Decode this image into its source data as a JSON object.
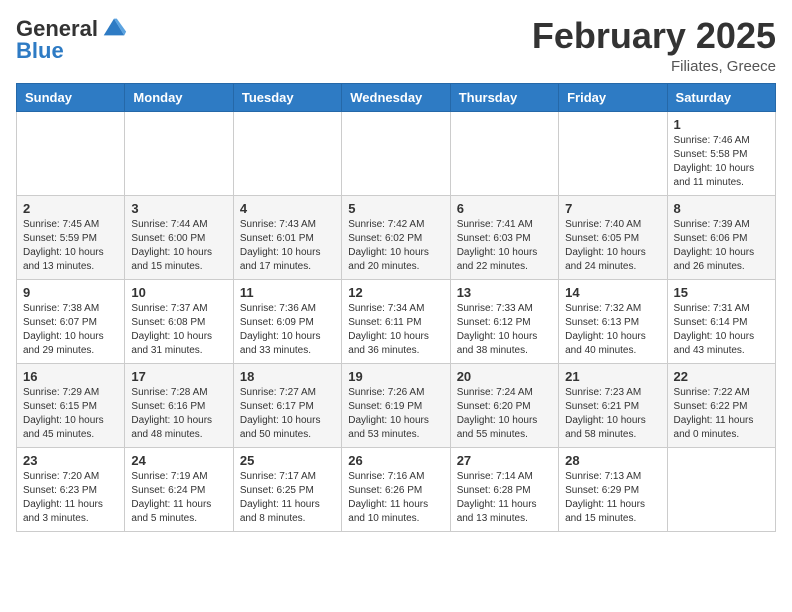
{
  "header": {
    "logo_general": "General",
    "logo_blue": "Blue",
    "month_title": "February 2025",
    "subtitle": "Filiates, Greece"
  },
  "days_of_week": [
    "Sunday",
    "Monday",
    "Tuesday",
    "Wednesday",
    "Thursday",
    "Friday",
    "Saturday"
  ],
  "weeks": [
    [
      {
        "day": "",
        "info": ""
      },
      {
        "day": "",
        "info": ""
      },
      {
        "day": "",
        "info": ""
      },
      {
        "day": "",
        "info": ""
      },
      {
        "day": "",
        "info": ""
      },
      {
        "day": "",
        "info": ""
      },
      {
        "day": "1",
        "info": "Sunrise: 7:46 AM\nSunset: 5:58 PM\nDaylight: 10 hours and 11 minutes."
      }
    ],
    [
      {
        "day": "2",
        "info": "Sunrise: 7:45 AM\nSunset: 5:59 PM\nDaylight: 10 hours and 13 minutes."
      },
      {
        "day": "3",
        "info": "Sunrise: 7:44 AM\nSunset: 6:00 PM\nDaylight: 10 hours and 15 minutes."
      },
      {
        "day": "4",
        "info": "Sunrise: 7:43 AM\nSunset: 6:01 PM\nDaylight: 10 hours and 17 minutes."
      },
      {
        "day": "5",
        "info": "Sunrise: 7:42 AM\nSunset: 6:02 PM\nDaylight: 10 hours and 20 minutes."
      },
      {
        "day": "6",
        "info": "Sunrise: 7:41 AM\nSunset: 6:03 PM\nDaylight: 10 hours and 22 minutes."
      },
      {
        "day": "7",
        "info": "Sunrise: 7:40 AM\nSunset: 6:05 PM\nDaylight: 10 hours and 24 minutes."
      },
      {
        "day": "8",
        "info": "Sunrise: 7:39 AM\nSunset: 6:06 PM\nDaylight: 10 hours and 26 minutes."
      }
    ],
    [
      {
        "day": "9",
        "info": "Sunrise: 7:38 AM\nSunset: 6:07 PM\nDaylight: 10 hours and 29 minutes."
      },
      {
        "day": "10",
        "info": "Sunrise: 7:37 AM\nSunset: 6:08 PM\nDaylight: 10 hours and 31 minutes."
      },
      {
        "day": "11",
        "info": "Sunrise: 7:36 AM\nSunset: 6:09 PM\nDaylight: 10 hours and 33 minutes."
      },
      {
        "day": "12",
        "info": "Sunrise: 7:34 AM\nSunset: 6:11 PM\nDaylight: 10 hours and 36 minutes."
      },
      {
        "day": "13",
        "info": "Sunrise: 7:33 AM\nSunset: 6:12 PM\nDaylight: 10 hours and 38 minutes."
      },
      {
        "day": "14",
        "info": "Sunrise: 7:32 AM\nSunset: 6:13 PM\nDaylight: 10 hours and 40 minutes."
      },
      {
        "day": "15",
        "info": "Sunrise: 7:31 AM\nSunset: 6:14 PM\nDaylight: 10 hours and 43 minutes."
      }
    ],
    [
      {
        "day": "16",
        "info": "Sunrise: 7:29 AM\nSunset: 6:15 PM\nDaylight: 10 hours and 45 minutes."
      },
      {
        "day": "17",
        "info": "Sunrise: 7:28 AM\nSunset: 6:16 PM\nDaylight: 10 hours and 48 minutes."
      },
      {
        "day": "18",
        "info": "Sunrise: 7:27 AM\nSunset: 6:17 PM\nDaylight: 10 hours and 50 minutes."
      },
      {
        "day": "19",
        "info": "Sunrise: 7:26 AM\nSunset: 6:19 PM\nDaylight: 10 hours and 53 minutes."
      },
      {
        "day": "20",
        "info": "Sunrise: 7:24 AM\nSunset: 6:20 PM\nDaylight: 10 hours and 55 minutes."
      },
      {
        "day": "21",
        "info": "Sunrise: 7:23 AM\nSunset: 6:21 PM\nDaylight: 10 hours and 58 minutes."
      },
      {
        "day": "22",
        "info": "Sunrise: 7:22 AM\nSunset: 6:22 PM\nDaylight: 11 hours and 0 minutes."
      }
    ],
    [
      {
        "day": "23",
        "info": "Sunrise: 7:20 AM\nSunset: 6:23 PM\nDaylight: 11 hours and 3 minutes."
      },
      {
        "day": "24",
        "info": "Sunrise: 7:19 AM\nSunset: 6:24 PM\nDaylight: 11 hours and 5 minutes."
      },
      {
        "day": "25",
        "info": "Sunrise: 7:17 AM\nSunset: 6:25 PM\nDaylight: 11 hours and 8 minutes."
      },
      {
        "day": "26",
        "info": "Sunrise: 7:16 AM\nSunset: 6:26 PM\nDaylight: 11 hours and 10 minutes."
      },
      {
        "day": "27",
        "info": "Sunrise: 7:14 AM\nSunset: 6:28 PM\nDaylight: 11 hours and 13 minutes."
      },
      {
        "day": "28",
        "info": "Sunrise: 7:13 AM\nSunset: 6:29 PM\nDaylight: 11 hours and 15 minutes."
      },
      {
        "day": "",
        "info": ""
      }
    ]
  ]
}
